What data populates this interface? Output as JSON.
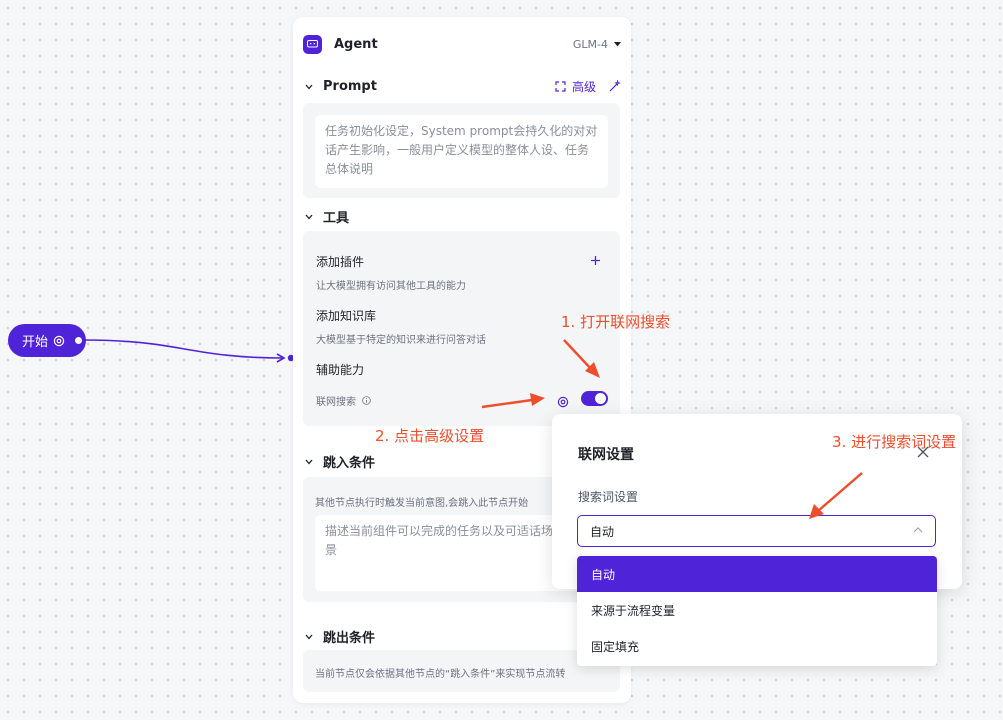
{
  "canvas": {
    "start_node": {
      "label": "开始"
    }
  },
  "agent_card": {
    "title": "Agent",
    "model": "GLM-4",
    "prompt_section": {
      "title": "Prompt",
      "advanced_label": "高级",
      "placeholder": "任务初始化设定，System prompt会持久化的对对话产生影响，一般用户定义模型的整体人设、任务总体说明"
    },
    "tools_section": {
      "title": "工具",
      "add_plugin": {
        "title": "添加插件",
        "desc": "让大模型拥有访问其他工具的能力"
      },
      "add_knowledge": {
        "title": "添加知识库",
        "desc": "大模型基于特定的知识来进行问答对话"
      },
      "assist": {
        "title": "辅助能力",
        "web_search_label": "联网搜索"
      }
    },
    "jump_in_section": {
      "title": "跳入条件",
      "desc": "其他节点执行时触发当前意图,会跳入此节点开始",
      "placeholder": "描述当前组件可以完成的任务以及可适话场景"
    },
    "jump_out_section": {
      "title": "跳出条件",
      "desc": "当前节点仅会依据其他节点的“跳入条件”来实现节点流转"
    }
  },
  "web_settings_popover": {
    "title": "联网设置",
    "field_label": "搜索词设置",
    "selected_value": "自动",
    "options": [
      "自动",
      "来源于流程变量",
      "固定填充"
    ]
  },
  "annotations": {
    "step1": "1. 打开联网搜索",
    "step2": "2. 点击高级设置",
    "step3": "3. 进行搜索词设置"
  },
  "colors": {
    "accent": "#4f23d8",
    "annotation": "#ee4e2c"
  }
}
